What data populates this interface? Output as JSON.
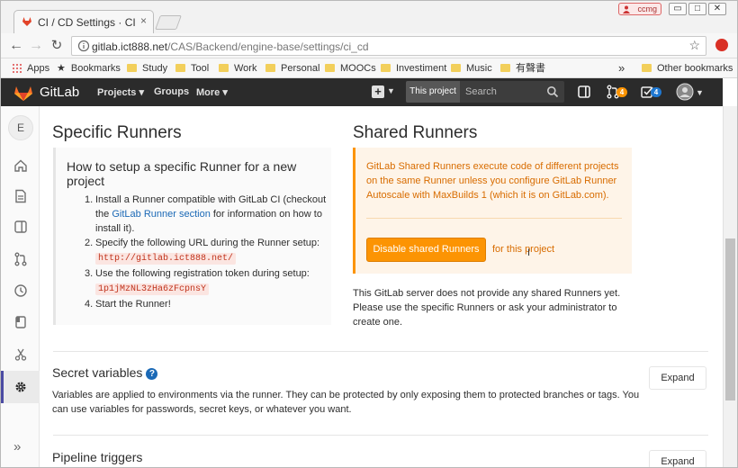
{
  "browser": {
    "tab_title": "CI / CD Settings · CI / CD",
    "tab_close": "×",
    "user_badge": "ccmg",
    "window_min": "▭",
    "window_max": "□",
    "window_close": "✕",
    "url_host": "gitlab.ict888.net",
    "url_path": "/CAS/Backend/engine-base/settings/ci_cd"
  },
  "bookmarks": {
    "apps": "Apps",
    "items": [
      "Bookmarks",
      "Study",
      "Tool",
      "Work",
      "Personal",
      "MOOCs",
      "Investiment",
      "Music",
      "有聲書"
    ],
    "overflow": "»",
    "other": "Other bookmarks"
  },
  "gitlab_nav": {
    "brand": "GitLab",
    "projects": "Projects ▾",
    "groups": "Groups",
    "more": "More ▾",
    "scope": "This project",
    "search_placeholder": "Search",
    "issues_count": "4",
    "todos_count": "4",
    "accent_color": "#fc6d26",
    "badge_colors": {
      "issues": "#fc9403",
      "todos": "#1f78d1"
    }
  },
  "sidebar": {
    "avatar_letter": "E",
    "items": [
      "home-icon",
      "doc-icon",
      "board-icon",
      "merge-request-icon",
      "clock-icon",
      "wiki-icon",
      "snippet-icon",
      "settings-icon"
    ],
    "collapse": "»"
  },
  "specific": {
    "title": "Specific Runners",
    "howto_title": "How to setup a specific Runner for a new project",
    "step1_a": "Install a Runner compatible with GitLab CI (checkout the ",
    "step1_link": "GitLab Runner section",
    "step1_b": " for information on how to install it).",
    "step2": "Specify the following URL during the Runner setup: ",
    "runner_url": "http://gitlab.ict888.net/",
    "step3": "Use the following registration token during setup: ",
    "token": "1p1jMzNL3zHa6zFcpnsY",
    "step4": "Start the Runner!"
  },
  "shared": {
    "title": "Shared Runners",
    "text": "GitLab Shared Runners execute code of different projects on the same Runner unless you configure GitLab Runner Autoscale with MaxBuilds 1 (which it is on GitLab.com).",
    "disable_button": "Disable shared Runners",
    "for_project": "for this project",
    "note": "This GitLab server does not provide any shared Runners yet. Please use the specific Runners or ask your administrator to create one."
  },
  "secret_variables": {
    "title": "Secret variables",
    "description": "Variables are applied to environments via the runner. They can be protected by only exposing them to protected branches or tags. You can use variables for passwords, secret keys, or whatever you want.",
    "expand": "Expand"
  },
  "pipeline_triggers": {
    "title": "Pipeline triggers",
    "expand": "Expand"
  }
}
